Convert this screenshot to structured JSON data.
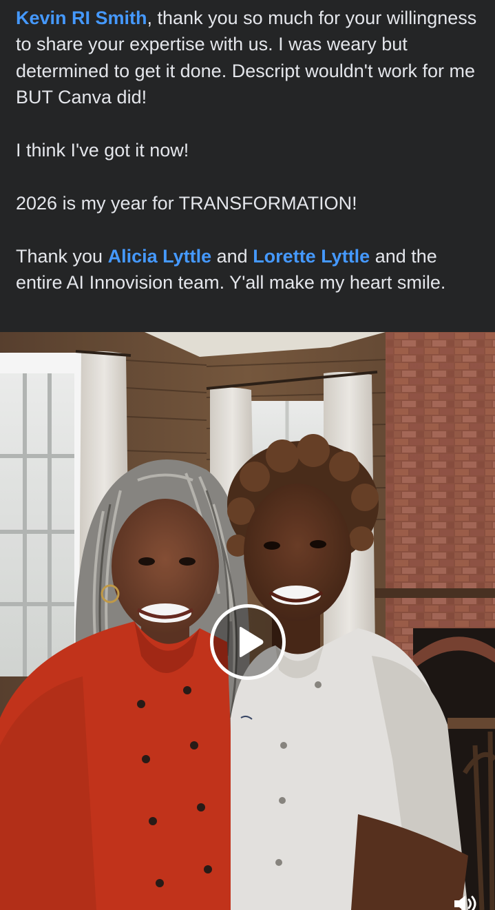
{
  "post": {
    "paragraph1": {
      "mention": "Kevin RI Smith",
      "text": ", thank you so much for your willingness to share your expertise with us. I was weary but determined to get it done. Descript wouldn't work for me BUT Canva did!"
    },
    "paragraph2": "I think I've got it now!",
    "paragraph3": "2026 is my year for TRANSFORMATION!",
    "paragraph4": {
      "prefix": "Thank you ",
      "mention1": "Alicia Lyttle",
      "middle": " and ",
      "mention2": "Lorette Lyttle",
      "suffix": " and the entire AI Innovision team. Y'all make my heart smile."
    }
  },
  "video": {
    "controls": {
      "play_icon": "play-icon",
      "volume_icon": "speaker-volume-icon"
    }
  },
  "colors": {
    "background": "#242526",
    "text": "#e4e6eb",
    "mention": "#4599ff"
  }
}
